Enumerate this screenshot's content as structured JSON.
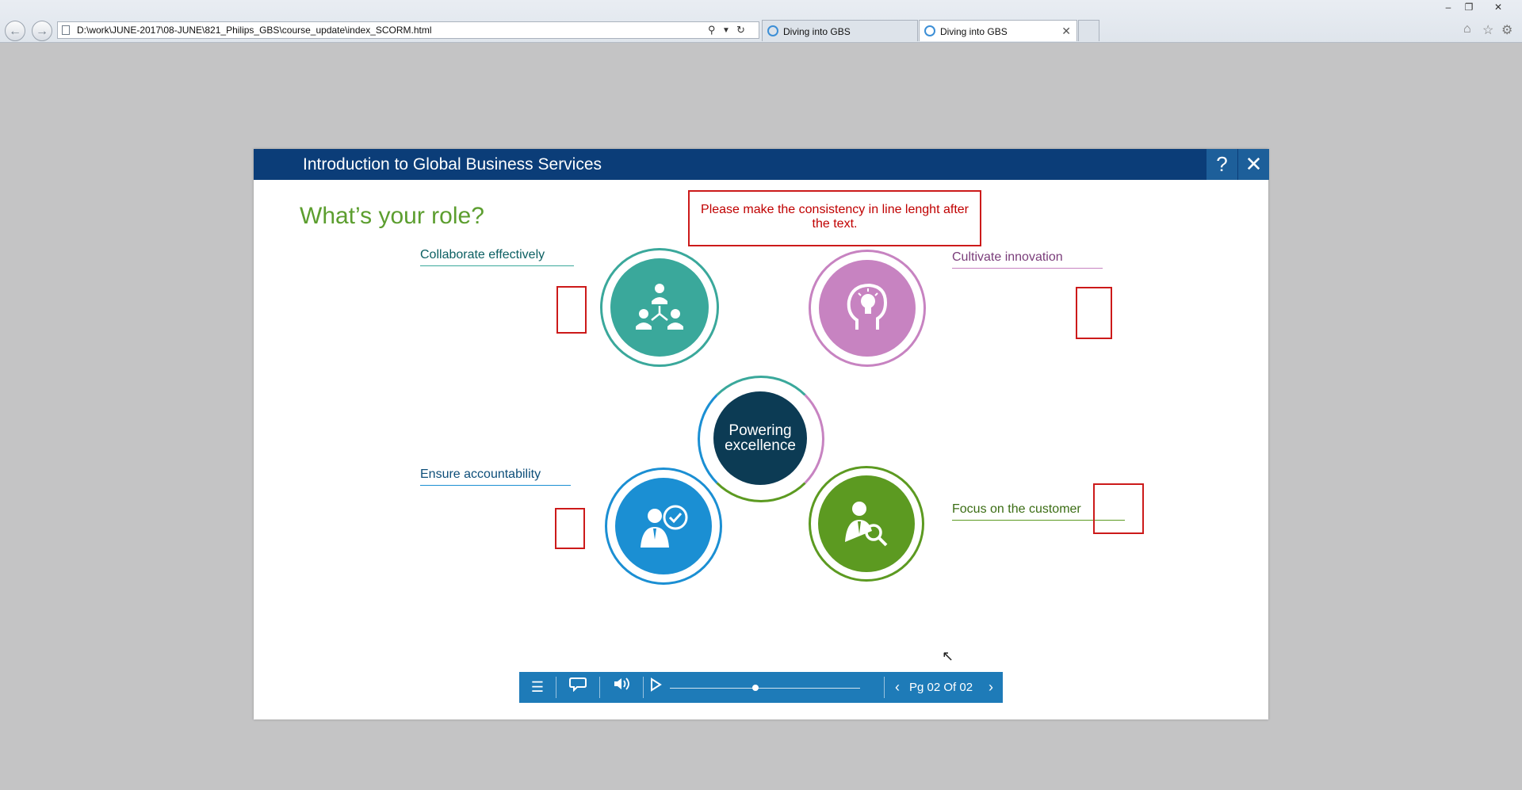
{
  "browser": {
    "url": "D:\\work\\JUNE-2017\\08-JUNE\\821_Philips_GBS\\course_update\\index_SCORM.html",
    "tabs": [
      {
        "label": "Diving into GBS",
        "active": false
      },
      {
        "label": "Diving into GBS",
        "active": true
      }
    ]
  },
  "course": {
    "title": "Introduction to Global Business Services",
    "help_label": "?",
    "close_label": "✕",
    "heading": "What’s your role?",
    "review_note": "Please make the consistency in line lenght after the text.",
    "center_label_line1": "Powering",
    "center_label_line2": "excellence",
    "roles": {
      "collaborate": "Collaborate effectively",
      "innovation": "Cultivate innovation",
      "accountability": "Ensure accountability",
      "customer": "Focus on the customer"
    },
    "colors": {
      "header": "#0b3d78",
      "teal": "#3aa89b",
      "lilac": "#c783c1",
      "blue": "#1b8fd3",
      "green": "#5c9a21",
      "center": "#0c3b54",
      "heading": "#5c9e2f",
      "player": "#1e7bb8"
    }
  },
  "player": {
    "menu_icon": "menu-icon",
    "transcript_icon": "speech-bubble-icon",
    "volume_icon": "volume-icon",
    "play_icon": "play-icon",
    "progress": 0.45,
    "page_label": "Pg 02 Of 02"
  }
}
